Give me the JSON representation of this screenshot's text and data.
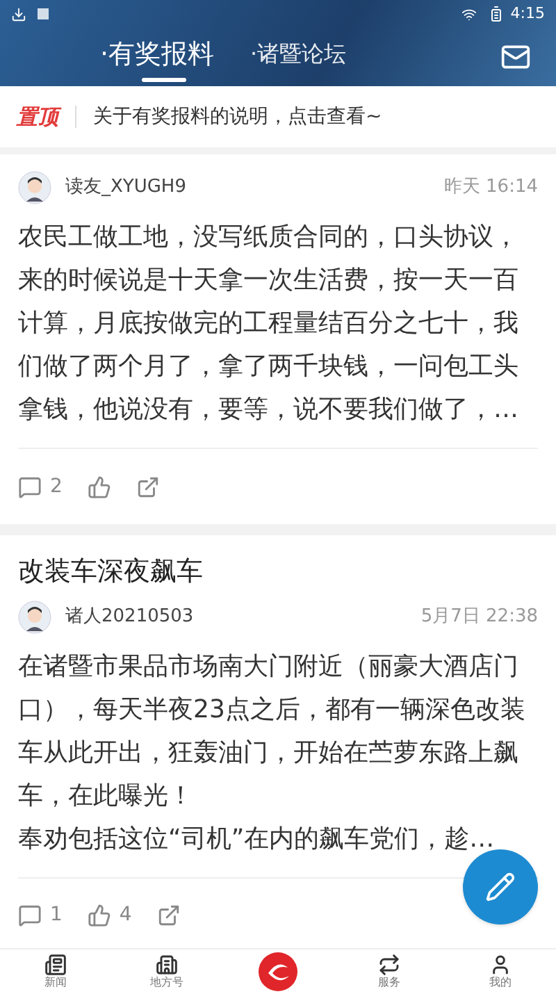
{
  "status_bar": {
    "time": "4:15"
  },
  "header": {
    "tabs": [
      {
        "label": "·有奖报料",
        "selected": true
      },
      {
        "label": "·诸暨论坛",
        "selected": false
      }
    ]
  },
  "pinned": {
    "tag": "置顶",
    "text": "关于有奖报料的说明，点击查看~"
  },
  "posts": [
    {
      "author": "读友_XYUGH9",
      "time": "昨天 16:14",
      "paragraphs": [
        "农民工做工地，没写纸质合同的，口头协议，来的时候说是十天拿一次生活费，按一天一百计算，月底按做完的工程量结百分之七十，我们做了两个月了，拿了两千块钱，一问包工头拿钱，他说没有，要等，说不要我们做了，…"
      ],
      "comments": "2"
    },
    {
      "title": "改装车深夜飙车",
      "author": "诸人20210503",
      "time": "5月7日 22:38",
      "paragraphs": [
        "在诸暨市果品市场南大门附近（丽豪大酒店门口），每天半夜23点之后，都有一辆深色改装车从此开出，狂轰油门，开始在苎萝东路上飙车，在此曝光！",
        "奉劝包括这位“司机”在内的飙车党们，趁…"
      ],
      "comments": "1",
      "likes": "4"
    }
  ],
  "bottom_nav": [
    {
      "label": "新闻",
      "kind": "news"
    },
    {
      "label": "地方号",
      "kind": "local"
    },
    {
      "kind": "logo"
    },
    {
      "label": "服务",
      "kind": "service"
    },
    {
      "label": "我的",
      "kind": "me"
    }
  ]
}
